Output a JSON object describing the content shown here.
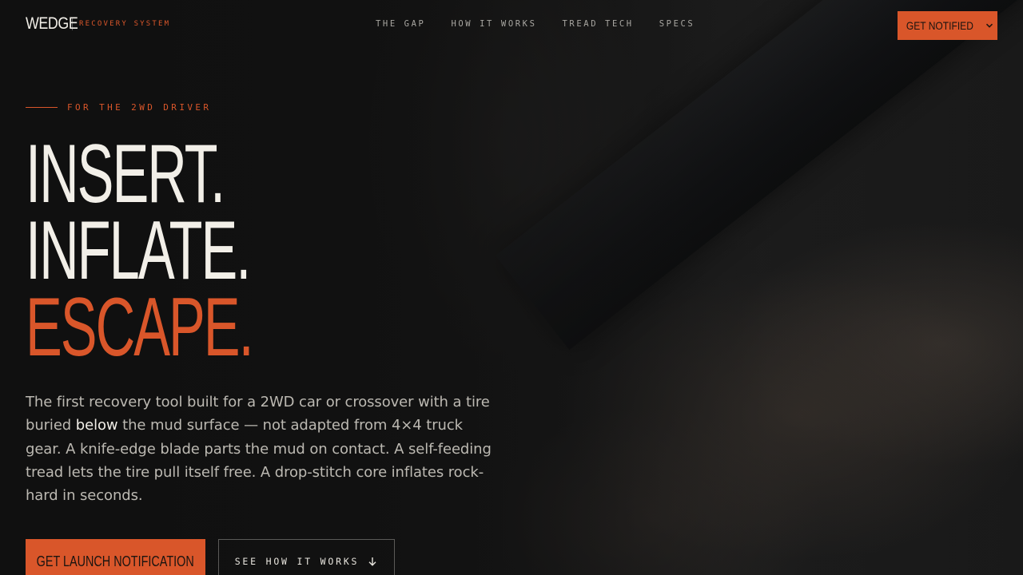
{
  "brand": {
    "name": "WEDGE",
    "tagline": "RECOVERY SYSTEM"
  },
  "nav": {
    "links": [
      "THE GAP",
      "HOW IT WORKS",
      "TREAD TECH",
      "SPECS"
    ],
    "cta_label": "GET NOTIFIED"
  },
  "hero": {
    "eyebrow": "FOR THE 2WD DRIVER",
    "headline": [
      "INSERT.",
      "INFLATE.",
      "ESCAPE."
    ],
    "body_part1": "The first recovery tool built for a 2WD car or crossover with a tire buried ",
    "body_highlight": "below",
    "body_part2": " the mud surface — not adapted from 4×4 truck gear. A knife-edge blade parts the mud on contact. A self-feeding tread lets the tire pull itself free. A drop-stitch core inflates rock-hard in seconds.",
    "primary_cta": "GET LAUNCH NOTIFICATION",
    "secondary_cta": "SEE HOW IT WORKS"
  },
  "colors": {
    "accent": "#d9562a",
    "background": "#141414",
    "text_primary": "#f2efe8",
    "text_muted": "#bcb9b2"
  },
  "icons": {
    "nav_cta": "chevron-down-icon",
    "secondary_cta": "arrow-down-icon"
  }
}
